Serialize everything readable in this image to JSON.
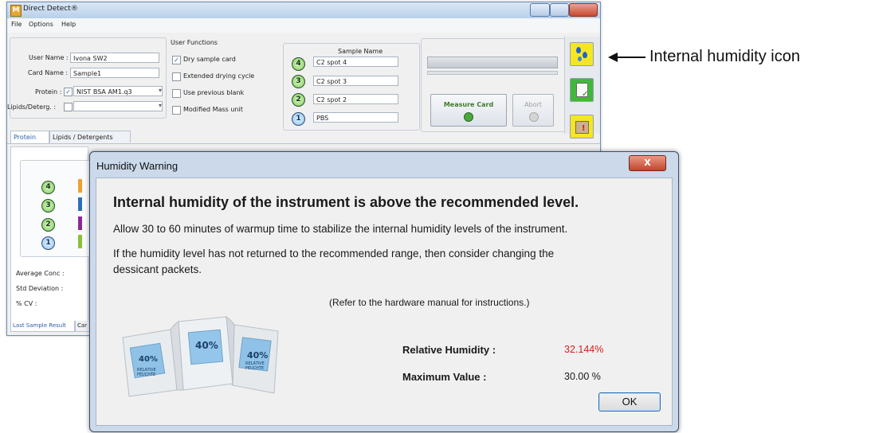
{
  "app": {
    "title": "Direct Detect®",
    "logo": "M"
  },
  "menu": [
    "File",
    "Options",
    "Help"
  ],
  "form": {
    "user_name_label": "User Name :",
    "user_name_value": "Ivona SW2",
    "card_name_label": "Card Name :",
    "card_name_value": "Sample1",
    "protein_label": "Protein :",
    "protein_value": "NIST BSA AM1.q3",
    "lipids_label": "Lipids/Deterg. :",
    "lipids_value": ""
  },
  "user_functions": {
    "title": "User Functions",
    "items": [
      {
        "label": "Dry sample card",
        "checked": true
      },
      {
        "label": "Extended drying cycle",
        "checked": false
      },
      {
        "label": "Use previous blank",
        "checked": false
      },
      {
        "label": "Modified Mass unit",
        "checked": false
      }
    ]
  },
  "samples": {
    "title": "Sample Name",
    "rows": [
      {
        "num": "4",
        "name": "C2 spot 4"
      },
      {
        "num": "3",
        "name": "C2 spot 3"
      },
      {
        "num": "2",
        "name": "C2 spot 2"
      },
      {
        "num": "1",
        "name": "PBS"
      }
    ]
  },
  "actions": {
    "measure": "Measure Card",
    "abort": "Abort"
  },
  "tabs": [
    "Protein",
    "Lipids / Detergents"
  ],
  "results": {
    "nums": [
      "4",
      "3",
      "2",
      "1"
    ],
    "bar_colors": [
      "#f0a030",
      "#2f6fb8",
      "#8a2a9a",
      "#8dbf3a"
    ],
    "avg_label": "Average Conc :",
    "std_label": "Std Deviation :",
    "cv_label": "% CV :"
  },
  "bottom_tabs": [
    "Last Sample Result",
    "Car"
  ],
  "side_icons": [
    "internal-humidity-icon",
    "card-check-icon",
    "warning-icon"
  ],
  "annotation": "Internal humidity icon",
  "dialog": {
    "title": "Humidity Warning",
    "close": "X",
    "heading": "Internal humidity of the instrument is above the recommended level.",
    "line1": "Allow 30 to 60 minutes of warmup time to stabilize the internal humidity levels of the instrument.",
    "line2a": "If the humidity level has not returned to the recommended range, then consider changing the",
    "line2b": "dessicant packets.",
    "refer": "(Refer to the hardware manual for instructions.)",
    "rh_label": "Relative Humidity :",
    "rh_value": "32.144%",
    "max_label": "Maximum Value :",
    "max_value": "30.00 %",
    "ok": "OK",
    "packet_text": "40%",
    "packet_sub": "RELATIVE FEUCHTE"
  },
  "colors": {
    "rh_value": "#d42020",
    "accent": "#2d6bb0"
  }
}
